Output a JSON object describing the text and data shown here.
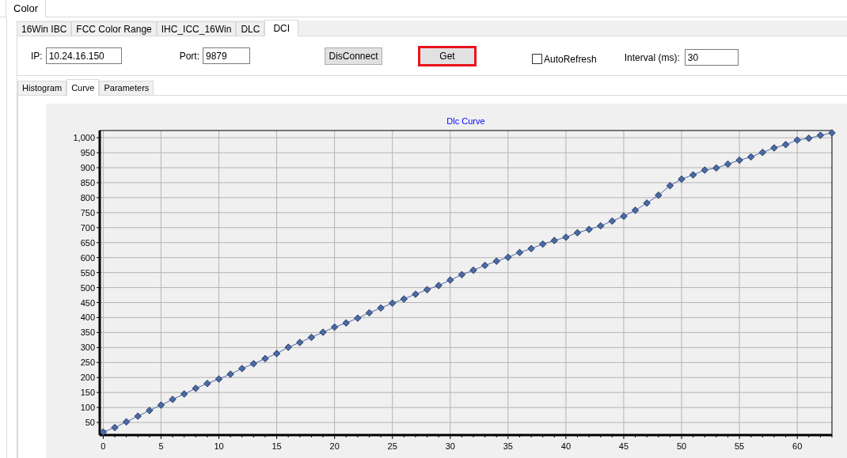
{
  "top_tabs": [
    {
      "label": "Color",
      "selected": true
    }
  ],
  "tabs": [
    {
      "label": "16Win IBC",
      "selected": false
    },
    {
      "label": "FCC Color Range",
      "selected": false
    },
    {
      "label": "IHC_ICC_16Win",
      "selected": false
    },
    {
      "label": "DLC",
      "selected": false
    },
    {
      "label": "DCI",
      "selected": true
    }
  ],
  "connection": {
    "ip_label": "IP:",
    "ip_value": "10.24.16.150",
    "port_label": "Port:",
    "port_value": "9879",
    "disconnect_button": "DisConnect",
    "get_button": {
      "label": "Get",
      "highlighted": true
    },
    "auto_refresh": {
      "label": "AutoRefresh",
      "checked": false
    },
    "interval_label": "Interval (ms):",
    "interval_value": "30"
  },
  "sub_tabs": [
    {
      "label": "Histogram",
      "selected": false
    },
    {
      "label": "Curve",
      "selected": true
    },
    {
      "label": "Parameters",
      "selected": false
    }
  ],
  "chart_data": {
    "type": "line",
    "title": "Dlc Curve",
    "grid": true,
    "xlim": [
      -0.3,
      63
    ],
    "ylim": [
      8,
      1024
    ],
    "x": [
      0,
      1,
      2,
      3,
      4,
      5,
      6,
      7,
      8,
      9,
      10,
      11,
      12,
      13,
      14,
      15,
      16,
      17,
      18,
      19,
      20,
      21,
      22,
      23,
      24,
      25,
      26,
      27,
      28,
      29,
      30,
      31,
      32,
      33,
      34,
      35,
      36,
      37,
      38,
      39,
      40,
      41,
      42,
      43,
      44,
      45,
      46,
      47,
      48,
      49,
      50,
      51,
      52,
      53,
      54,
      55,
      56,
      57,
      58,
      59,
      60,
      61,
      62,
      63
    ],
    "xticks": [
      0,
      5,
      10,
      15,
      20,
      25,
      30,
      35,
      40,
      45,
      50,
      55,
      60
    ],
    "yticks": [
      50,
      100,
      150,
      200,
      250,
      300,
      350,
      400,
      450,
      500,
      550,
      600,
      650,
      700,
      750,
      800,
      850,
      900,
      950,
      {
        "value": 1000,
        "label": "1,000"
      }
    ],
    "series": [
      {
        "color": "#4a6aa8",
        "marker": "diamond",
        "values": [
          18,
          33,
          52,
          71,
          90,
          108,
          127,
          145,
          164,
          180,
          195,
          211,
          230,
          246,
          263,
          280,
          301,
          317,
          334,
          351,
          368,
          382,
          398,
          416,
          432,
          448,
          462,
          478,
          493,
          507,
          525,
          543,
          558,
          574,
          588,
          601,
          617,
          630,
          645,
          657,
          668,
          683,
          694,
          706,
          722,
          738,
          758,
          782,
          808,
          840,
          862,
          876,
          892,
          899,
          912,
          925,
          936,
          951,
          966,
          977,
          992,
          998,
          1008,
          1016
        ]
      }
    ]
  }
}
